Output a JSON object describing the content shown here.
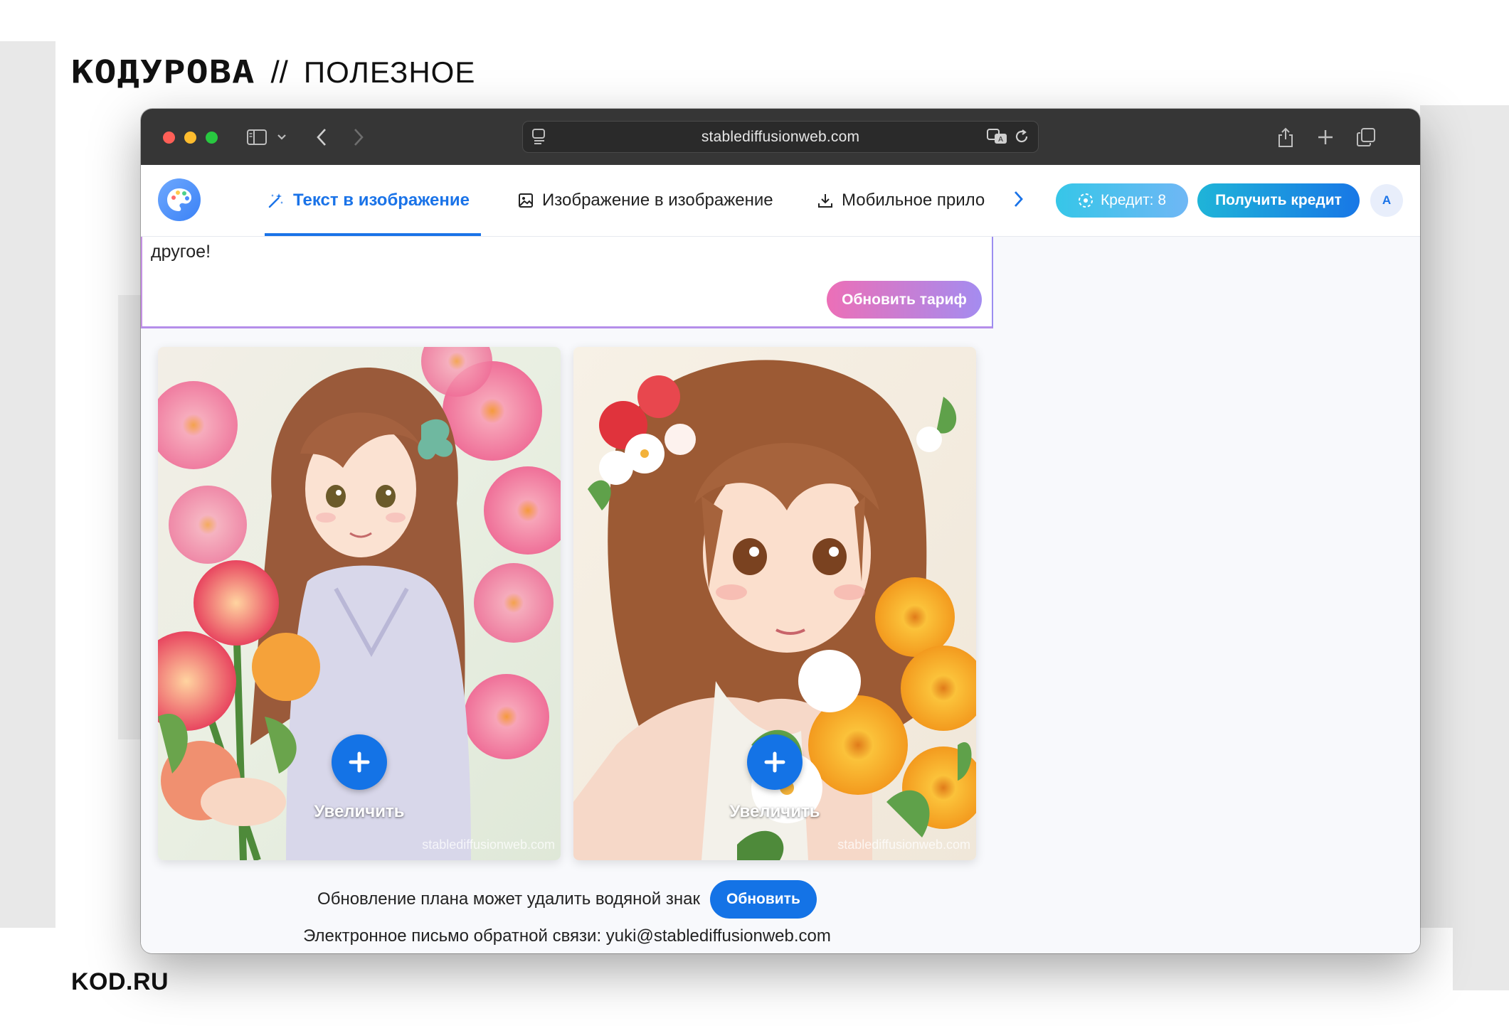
{
  "page": {
    "brand_logo": "KOДУРОВА",
    "brand_separator": "//",
    "brand_section": "ПОЛЕЗНОЕ",
    "footer_site": "KOD.RU"
  },
  "browser": {
    "url": "stablediffusionweb.com"
  },
  "nav": {
    "tabs": [
      {
        "label": "Текст в изображение",
        "active": true
      },
      {
        "label": "Изображение в изображение",
        "active": false
      },
      {
        "label": "Мобильное прило",
        "active": false
      }
    ],
    "credit_label": "Кредит: 8",
    "get_credit_label": "Получить кредит",
    "avatar_initial": "A"
  },
  "upgrade": {
    "text": "другое!",
    "button_label": "Обновить тариф"
  },
  "images": [
    {
      "zoom_label": "Увеличить",
      "watermark": "stablediffusionweb.com"
    },
    {
      "zoom_label": "Увеличить",
      "watermark": "stablediffusionweb.com"
    }
  ],
  "footer": {
    "watermark_note": "Обновление плана может удалить водяной знак",
    "upgrade_button": "Обновить",
    "feedback": "Электронное письмо обратной связи: yuki@stablediffusionweb.com"
  },
  "colors": {
    "accent": "#1a73e8",
    "button_blue": "#1473e6",
    "credit_gradient": [
      "#36c6e8",
      "#6fb7f5"
    ],
    "upgrade_gradient": [
      "#ec6fb7",
      "#a48cf0"
    ]
  }
}
